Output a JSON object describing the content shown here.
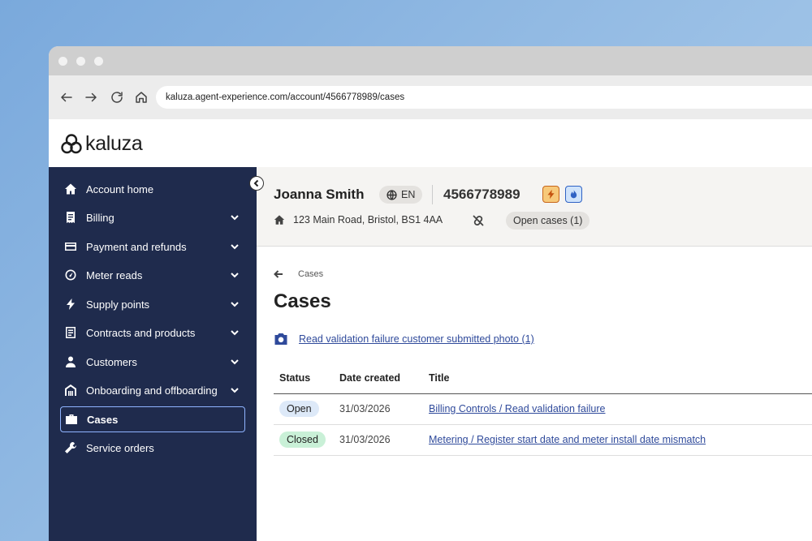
{
  "browser": {
    "url": "kaluza.agent-experience.com/account/4566778989/cases"
  },
  "app": {
    "logo_text": "kaluza"
  },
  "sidebar": {
    "items": [
      {
        "label": "Account home",
        "icon": "home-icon",
        "has_chevron": false
      },
      {
        "label": "Billing",
        "icon": "receipt-icon",
        "has_chevron": true
      },
      {
        "label": "Payment and refunds",
        "icon": "credit-card-icon",
        "has_chevron": true
      },
      {
        "label": "Meter reads",
        "icon": "gauge-icon",
        "has_chevron": true
      },
      {
        "label": "Supply points",
        "icon": "lightning-icon",
        "has_chevron": true
      },
      {
        "label": "Contracts and products",
        "icon": "document-icon",
        "has_chevron": true
      },
      {
        "label": "Customers",
        "icon": "person-icon",
        "has_chevron": true
      },
      {
        "label": "Onboarding and offboarding",
        "icon": "building-icon",
        "has_chevron": true
      },
      {
        "label": "Cases",
        "icon": "briefcase-icon",
        "has_chevron": false,
        "active": true
      },
      {
        "label": "Service orders",
        "icon": "wrench-icon",
        "has_chevron": false
      }
    ]
  },
  "customer": {
    "name": "Joanna Smith",
    "language": "EN",
    "account_number": "4566778989",
    "address": "123 Main Road, Bristol, BS1 4AA",
    "open_cases": "Open cases (1)",
    "fuel_icons": [
      "electricity-icon",
      "gas-icon"
    ]
  },
  "page": {
    "breadcrumb": "Cases",
    "title": "Cases",
    "photo_link": "Read validation failure customer submitted photo (1)"
  },
  "table": {
    "headers": [
      "Status",
      "Date created",
      "Title"
    ],
    "rows": [
      {
        "status": "Open",
        "date": "31/03/2026",
        "title": "Billing Controls / Read validation failure"
      },
      {
        "status": "Closed",
        "date": "31/03/2026",
        "title": "Metering / Register start date and meter install date mismatch"
      }
    ]
  },
  "colors": {
    "sidebar_bg": "#1f2b4d",
    "link": "#2f4a9b",
    "open_badge": "#dde9f8",
    "closed_badge": "#c9f0d7",
    "electricity_badge": "#f7c97a",
    "gas_badge": "#cfe3fb"
  }
}
